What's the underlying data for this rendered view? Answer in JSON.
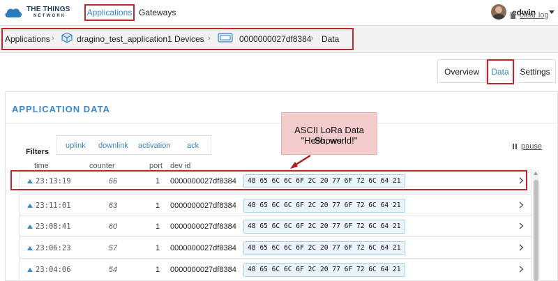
{
  "nav": {
    "logo_line1": "THE THINGS",
    "logo_line2": "NETWORK",
    "applications": "Applications",
    "gateways": "Gateways",
    "username": "edwin"
  },
  "breadcrumb": {
    "items": [
      "Applications",
      "dragino_test_application1",
      "Devices",
      "0000000027df8384",
      "Data"
    ]
  },
  "tabs": {
    "overview": "Overview",
    "data": "Data",
    "settings": "Settings"
  },
  "panel": {
    "title": "APPLICATION DATA",
    "clear_log": "clear log",
    "pause": "pause",
    "filters_label": "Filters",
    "filters": [
      "uplink",
      "downlink",
      "activation",
      "ack"
    ],
    "columns": [
      "time",
      "counter",
      "port",
      "dev id"
    ]
  },
  "annotation": {
    "line1": "ASCII LoRa Data Shows:",
    "line2": "\"Hello, world!\""
  },
  "rows": [
    {
      "time": "23:13:19",
      "counter": "66",
      "port": "1",
      "dev_id": "0000000027df8384",
      "payload": "48 65 6C 6C 6F 2C 20 77 6F 72 6C 64 21"
    },
    {
      "time": "23:11:01",
      "counter": "63",
      "port": "1",
      "dev_id": "0000000027df8384",
      "payload": "48 65 6C 6C 6F 2C 20 77 6F 72 6C 64 21"
    },
    {
      "time": "23:08:41",
      "counter": "60",
      "port": "1",
      "dev_id": "0000000027df8384",
      "payload": "48 65 6C 6C 6F 2C 20 77 6F 72 6C 64 21"
    },
    {
      "time": "23:06:23",
      "counter": "57",
      "port": "1",
      "dev_id": "0000000027df8384",
      "payload": "48 65 6C 6C 6F 2C 20 77 6F 72 6C 64 21"
    },
    {
      "time": "23:04:06",
      "counter": "54",
      "port": "1",
      "dev_id": "0000000027df8384",
      "payload": "48 65 6C 6C 6F 2C 20 77 6F 72 6C 64 21"
    }
  ],
  "colors": {
    "accent": "#3b87c8",
    "highlight": "#c0272d",
    "annotation_bg": "#f4cccc"
  }
}
